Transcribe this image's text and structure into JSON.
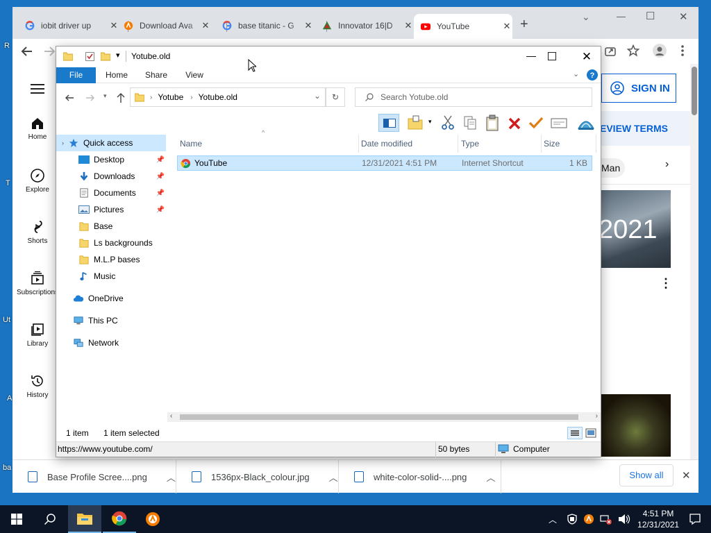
{
  "desktop": {
    "fragments": [
      "R",
      "T",
      "Ut",
      "A",
      "ba"
    ]
  },
  "browser": {
    "tabs": [
      {
        "title": "iobit driver up",
        "close": "✕"
      },
      {
        "title": "Download Ava",
        "close": "✕"
      },
      {
        "title": "base titanic - G",
        "close": "✕"
      },
      {
        "title": "Innovator 16|D",
        "close": "✕"
      },
      {
        "title": "YouTube",
        "close": "✕"
      }
    ],
    "new_tab": "+",
    "window_controls": {
      "dropdown": "⌄",
      "minimize": "—",
      "restore": "☐",
      "close": "✕"
    }
  },
  "youtube": {
    "sidebar": [
      {
        "label": "Home",
        "icon": "home-icon"
      },
      {
        "label": "Explore",
        "icon": "compass-icon"
      },
      {
        "label": "Shorts",
        "icon": "shorts-icon"
      },
      {
        "label": "Subscriptions",
        "icon": "subscriptions-icon"
      },
      {
        "label": "Library",
        "icon": "library-icon"
      },
      {
        "label": "History",
        "icon": "history-icon"
      }
    ],
    "sign_in": "SIGN IN",
    "review_terms": "EVIEW TERMS",
    "chip": "Man",
    "thumb_text": "2021",
    "accent": "#065fd4"
  },
  "explorer": {
    "title": "Yotube.old",
    "ribbon_tabs": {
      "file": "File",
      "home": "Home",
      "share": "Share",
      "view": "View"
    },
    "breadcrumb": [
      "Yotube",
      "Yotube.old"
    ],
    "search_placeholder": "Search Yotube.old",
    "nav": {
      "quick_access": "Quick access",
      "items": [
        {
          "label": "Desktop",
          "pinned": true
        },
        {
          "label": "Downloads",
          "pinned": true
        },
        {
          "label": "Documents",
          "pinned": true
        },
        {
          "label": "Pictures",
          "pinned": true
        },
        {
          "label": "Base",
          "pinned": false
        },
        {
          "label": "Ls backgrounds",
          "pinned": false
        },
        {
          "label": "M.L.P bases",
          "pinned": false
        },
        {
          "label": "Music",
          "pinned": false
        }
      ],
      "onedrive": "OneDrive",
      "this_pc": "This PC",
      "network": "Network"
    },
    "columns": {
      "name": "Name",
      "date": "Date modified",
      "type": "Type",
      "size": "Size"
    },
    "files": [
      {
        "name": "YouTube",
        "date": "12/31/2021 4:51 PM",
        "type": "Internet Shortcut",
        "size": "1 KB"
      }
    ],
    "status": {
      "count": "1 item",
      "selected": "1 item selected"
    },
    "statusbar": {
      "url": "https://www.youtube.com/",
      "bytes": "50 bytes",
      "location": "Computer"
    },
    "selection_color": "#cce8ff"
  },
  "downloads": {
    "items": [
      {
        "name": "Base Profile Scree....png"
      },
      {
        "name": "1536px-Black_colour.jpg"
      },
      {
        "name": "white-color-solid-....png"
      }
    ],
    "show_all": "Show all"
  },
  "taskbar": {
    "time": "4:51 PM",
    "date": "12/31/2021"
  }
}
